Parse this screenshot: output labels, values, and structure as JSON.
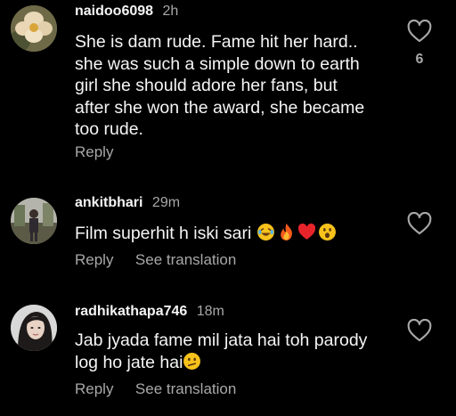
{
  "comments": [
    {
      "username": "naidoo6098",
      "time": "2h",
      "text_lines": [
        "She is dam rude. Fame hit her hard..",
        "she was such a simple down to earth",
        "girl she should adore her fans, but",
        "after she won the award,  she became",
        "too rude."
      ],
      "reply_label": "Reply",
      "like_count": "6",
      "avatar": "flower-photo"
    },
    {
      "username": "ankitbhari",
      "time": "29m",
      "text": "Film superhit h iski sari",
      "emojis": [
        "laughing-tears-emoji",
        "fire-emoji",
        "red-heart-emoji",
        "surprised-face-emoji"
      ],
      "reply_label": "Reply",
      "translate_label": "See translation",
      "avatar": "person-outdoor-photo"
    },
    {
      "username": "radhikathapa746",
      "time": "18m",
      "text_lines": [
        "Jab jyada fame mil jata hai toh parody",
        "log ho jate hai"
      ],
      "emojis": [
        "confused-face-emoji"
      ],
      "reply_label": "Reply",
      "translate_label": "See translation",
      "avatar": "woman-portrait-photo"
    }
  ],
  "colors": {
    "background": "#000000",
    "text": "#f5f5f5",
    "muted": "#a8a8a8"
  },
  "icons": {
    "like": "heart-outline-icon"
  }
}
